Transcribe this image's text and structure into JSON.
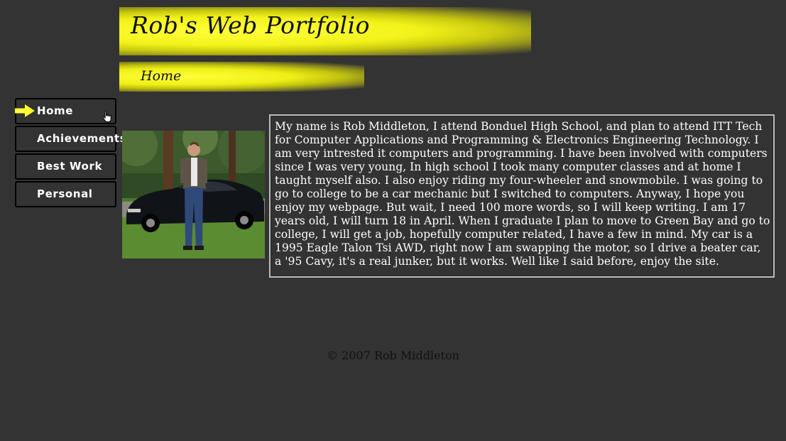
{
  "header": {
    "title": "Rob's Web Portfolio",
    "page_heading": "Home"
  },
  "nav": {
    "items": [
      {
        "label": "Home",
        "active": true
      },
      {
        "label": "Achievements",
        "active": false
      },
      {
        "label": "Best Work",
        "active": false
      },
      {
        "label": "Personal",
        "active": false
      }
    ]
  },
  "main": {
    "bio": "My name is Rob Middleton, I attend Bonduel High School, and plan to attend ITT Tech for Computer Applications and Programming & Electronics Engineering Technology. I am very intrested it computers and programming. I have been involved with computers since I was very young, In high school I took many computer classes and at home I taught myself also. I also enjoy riding my four-wheeler and snowmobile. I was going to go to college to be a car mechanic but I switched to computers. Anyway, I hope you enjoy my webpage. But wait, I need 100 more words, so I will keep writing. I am 17 years old, I will turn 18 in April. When I graduate I plan to move to Green Bay and go to college, I will get a job, hopefully computer related, I have a few in mind. My car is a 1995 Eagle Talon Tsi AWD, right now I am swapping the motor, so I drive a beater car, a '95 Cavy, it's a real junker, but it works. Well like I said before, enjoy the site."
  },
  "footer": {
    "copyright": "© 2007 Rob Middleton"
  },
  "colors": {
    "background": "#333333",
    "accent": "#ffff33",
    "text": "#ffffff"
  },
  "icons": {
    "active_marker": "arrow-right-icon",
    "pointer": "hand-pointer-icon"
  }
}
